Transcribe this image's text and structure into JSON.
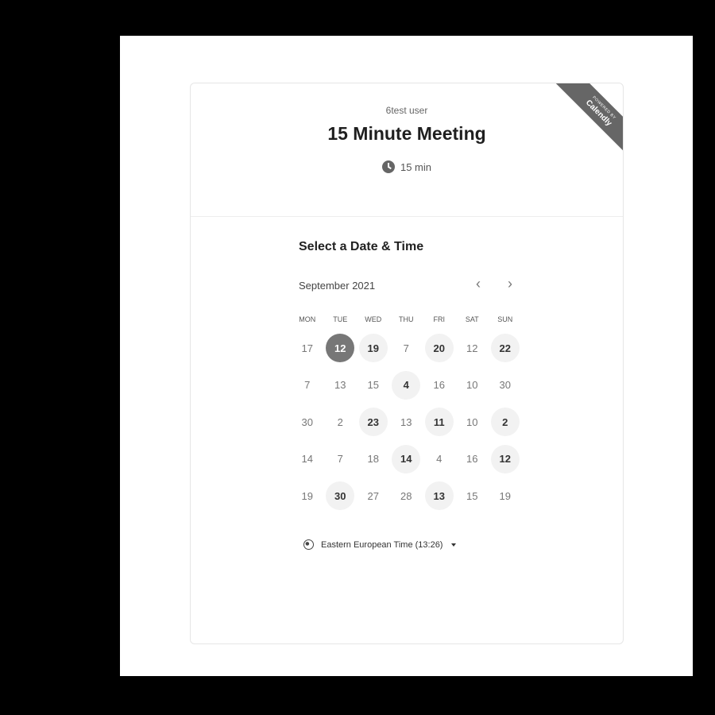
{
  "header": {
    "user_name": "6test user",
    "event_title": "15 Minute Meeting",
    "duration": "15 min"
  },
  "badge": {
    "top_text": "POWERED BY",
    "brand": "Calendly",
    "color": "#666666"
  },
  "calendar": {
    "section_title": "Select a Date & Time",
    "month_label": "September 2021",
    "prev_icon": "‹",
    "next_icon": "›",
    "weekdays": [
      "MON",
      "TUE",
      "WED",
      "THU",
      "FRI",
      "SAT",
      "SUN"
    ],
    "days": [
      {
        "label": "17",
        "state": "disabled"
      },
      {
        "label": "12",
        "state": "selected"
      },
      {
        "label": "19",
        "state": "available"
      },
      {
        "label": "7",
        "state": "disabled"
      },
      {
        "label": "20",
        "state": "available"
      },
      {
        "label": "12",
        "state": "disabled"
      },
      {
        "label": "22",
        "state": "available"
      },
      {
        "label": "7",
        "state": "disabled"
      },
      {
        "label": "13",
        "state": "disabled"
      },
      {
        "label": "15",
        "state": "disabled"
      },
      {
        "label": "4",
        "state": "available"
      },
      {
        "label": "16",
        "state": "disabled"
      },
      {
        "label": "10",
        "state": "disabled"
      },
      {
        "label": "30",
        "state": "disabled"
      },
      {
        "label": "30",
        "state": "disabled"
      },
      {
        "label": "2",
        "state": "disabled"
      },
      {
        "label": "23",
        "state": "available"
      },
      {
        "label": "13",
        "state": "disabled"
      },
      {
        "label": "11",
        "state": "available"
      },
      {
        "label": "10",
        "state": "disabled"
      },
      {
        "label": "2",
        "state": "available"
      },
      {
        "label": "14",
        "state": "disabled"
      },
      {
        "label": "7",
        "state": "disabled"
      },
      {
        "label": "18",
        "state": "disabled"
      },
      {
        "label": "14",
        "state": "available"
      },
      {
        "label": "4",
        "state": "disabled"
      },
      {
        "label": "16",
        "state": "disabled"
      },
      {
        "label": "12",
        "state": "available"
      },
      {
        "label": "19",
        "state": "disabled"
      },
      {
        "label": "30",
        "state": "available"
      },
      {
        "label": "27",
        "state": "disabled"
      },
      {
        "label": "28",
        "state": "disabled"
      },
      {
        "label": "13",
        "state": "available"
      },
      {
        "label": "15",
        "state": "disabled"
      },
      {
        "label": "19",
        "state": "disabled"
      }
    ]
  },
  "timezone": {
    "label": "Eastern European Time (13:26)"
  }
}
